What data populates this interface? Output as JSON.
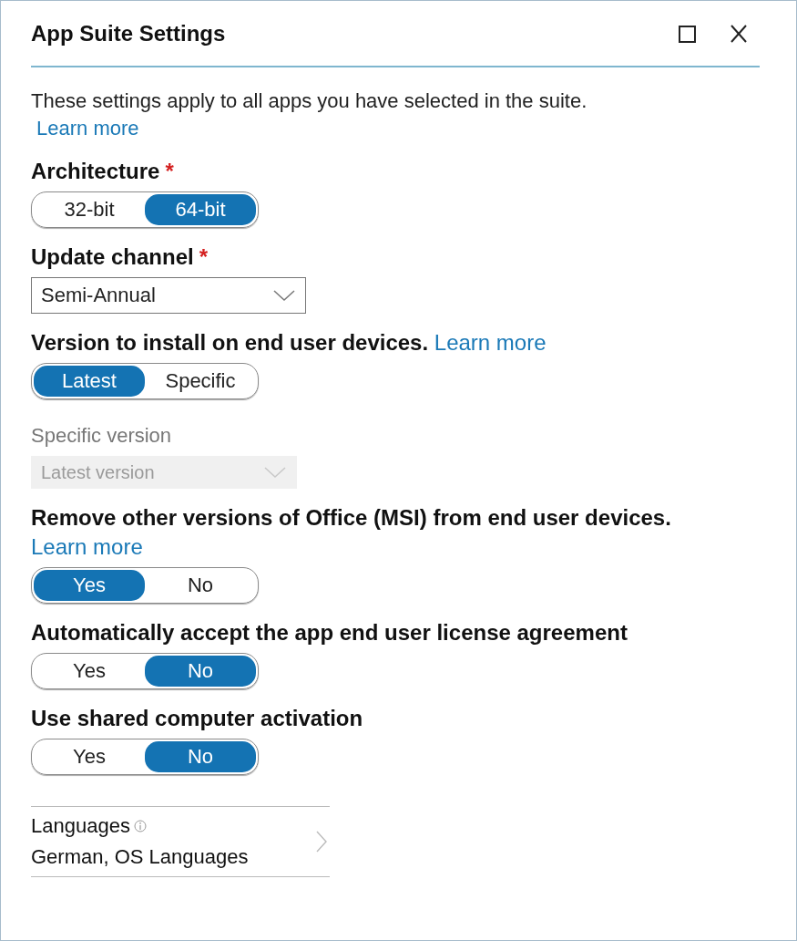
{
  "window": {
    "title": "App Suite Settings"
  },
  "description": {
    "text": "These settings apply to all apps you have selected in the suite.",
    "link": "Learn more"
  },
  "settings": [
    {
      "kind": "toggle",
      "label": "Architecture",
      "asterisk": "*",
      "options": [
        {
          "label": "32-bit",
          "selected": false
        },
        {
          "label": "64-bit",
          "selected": true
        }
      ]
    },
    {
      "kind": "dropdown",
      "label": "Update channel",
      "asterisk": "*",
      "value": "Semi-Annual",
      "disabled": false
    },
    {
      "kind": "toggle",
      "label": "Version to install on end user devices.",
      "link": "Learn more",
      "options": [
        {
          "label": "Latest",
          "selected": true
        },
        {
          "label": "Specific",
          "selected": false
        }
      ]
    },
    {
      "kind": "dropdown",
      "label": "Specific version",
      "value": "Latest version",
      "disabled": true
    },
    {
      "kind": "toggle",
      "label": "Remove other versions of Office (MSI) from end user devices.",
      "link": "Learn more",
      "options": [
        {
          "label": "Yes",
          "selected": true
        },
        {
          "label": "No",
          "selected": false
        }
      ]
    },
    {
      "kind": "toggle",
      "label": "Automatically accept the app end user license agreement",
      "options": [
        {
          "label": "Yes",
          "selected": false
        },
        {
          "label": "No",
          "selected": true
        }
      ]
    },
    {
      "kind": "toggle",
      "label": "Use shared computer activation",
      "options": [
        {
          "label": "Yes",
          "selected": false
        },
        {
          "label": "No",
          "selected": true
        }
      ]
    },
    {
      "kind": "nav",
      "label": "Languages",
      "info": true,
      "value": "German, OS Languages"
    }
  ]
}
